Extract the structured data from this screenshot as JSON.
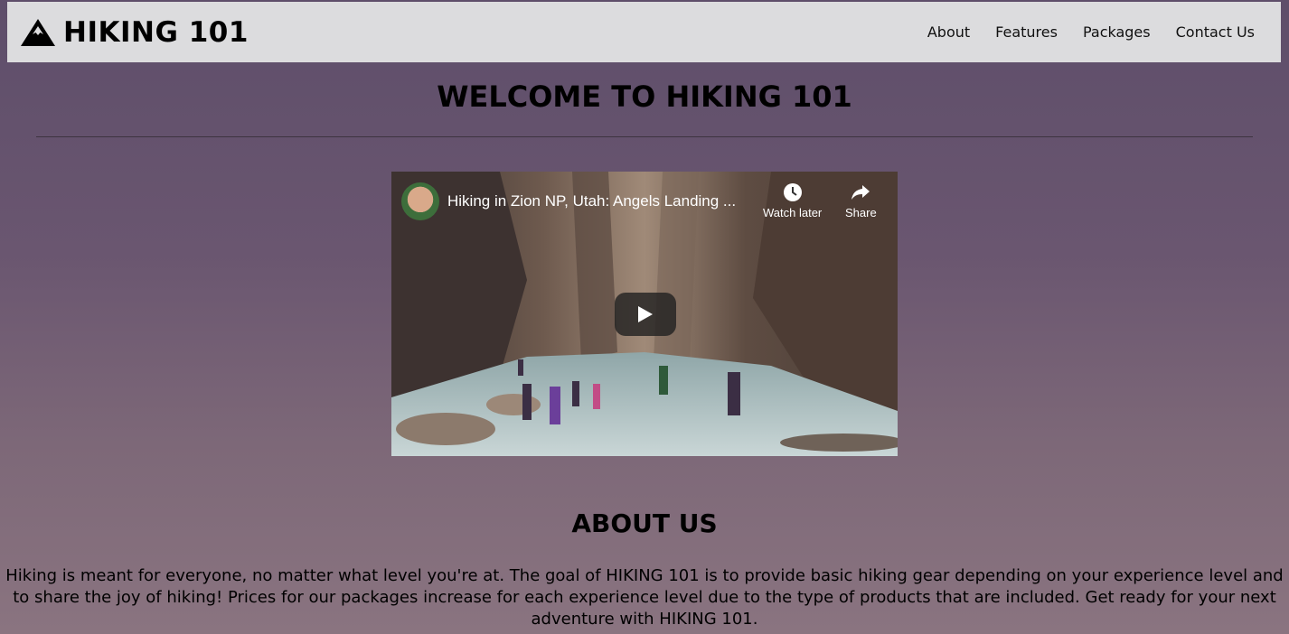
{
  "navbar": {
    "logo_icon": "mountain-icon",
    "brand": "HIKING 101",
    "links": [
      "About",
      "Features",
      "Packages",
      "Contact Us"
    ]
  },
  "welcome": {
    "heading": "WELCOME TO HIKING 101"
  },
  "video": {
    "title": "Hiking in Zion NP, Utah: Angels Landing ...",
    "watch_later_label": "Watch later",
    "watch_later_icon": "clock-icon",
    "share_label": "Share",
    "share_icon": "share-arrow-icon",
    "play_icon": "play-icon"
  },
  "about": {
    "heading": "ABOUT US",
    "text": "Hiking is meant for everyone, no matter what level you're at. The goal of HIKING 101 is to provide basic hiking gear depending on your experience level and to share the joy of hiking! Prices for our packages increase for each experience level due to the type of products that are included. Get ready for your next adventure with HIKING 101."
  },
  "colors": {
    "navbar_bg": "#dcdcde",
    "page_bg": "#6a5670",
    "text": "#000000"
  }
}
